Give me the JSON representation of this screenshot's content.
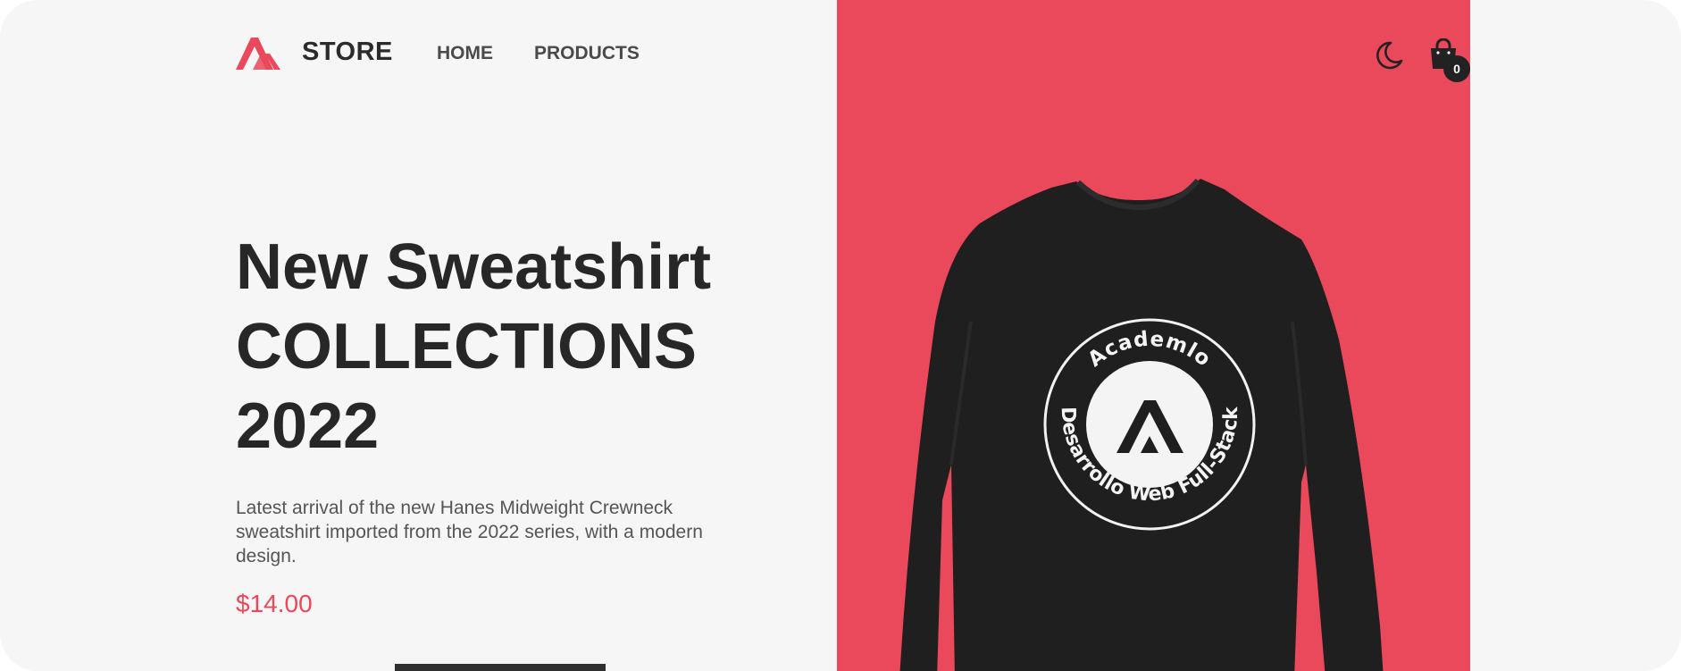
{
  "header": {
    "brand": "STORE",
    "nav": {
      "home": "HOME",
      "products": "PRODUCTS"
    },
    "cart_count": "0",
    "icons": {
      "logo": "academlo-logo-icon",
      "theme": "moon-icon",
      "cart": "shopping-bag-icon"
    }
  },
  "hero": {
    "title_line1": "New Sweatshirt",
    "title_line2": "COLLECTIONS",
    "title_line3": "2022",
    "description": "Latest arrival of the new Hanes Midweight Crewneck sweatshirt imported from the 2022 series, with a modern design.",
    "price": "$14.00",
    "image": {
      "emblem_top": "Academlo",
      "emblem_bottom": "Desarrollo Web Full-Stack"
    }
  },
  "colors": {
    "accent": "#e9495b",
    "background": "#f6f6f6",
    "text": "#272727"
  }
}
